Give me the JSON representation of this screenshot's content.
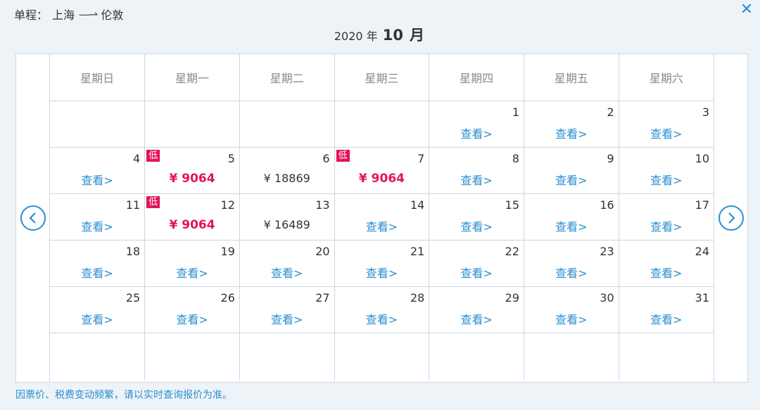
{
  "header": {
    "trip_type": "单程：",
    "origin": "上海",
    "arrow": "—⇀",
    "destination": "伦敦",
    "close_glyph": "✕"
  },
  "month": {
    "year": "2020",
    "year_unit": "年",
    "month": "10",
    "month_unit": "月"
  },
  "weekdays": [
    "星期日",
    "星期一",
    "星期二",
    "星期三",
    "星期四",
    "星期五",
    "星期六"
  ],
  "weeks": [
    [
      null,
      null,
      null,
      null,
      {
        "day": "1",
        "view": "查看>"
      },
      {
        "day": "2",
        "view": "查看>"
      },
      {
        "day": "3",
        "view": "查看>"
      }
    ],
    [
      {
        "day": "4",
        "view": "查看>"
      },
      {
        "day": "5",
        "badge": "低",
        "price": "¥ 9064",
        "low": true
      },
      {
        "day": "6",
        "price": "¥ 18869"
      },
      {
        "day": "7",
        "badge": "低",
        "price": "¥ 9064",
        "low": true
      },
      {
        "day": "8",
        "view": "查看>"
      },
      {
        "day": "9",
        "view": "查看>"
      },
      {
        "day": "10",
        "view": "查看>"
      }
    ],
    [
      {
        "day": "11",
        "view": "查看>"
      },
      {
        "day": "12",
        "badge": "低",
        "price": "¥ 9064",
        "low": true
      },
      {
        "day": "13",
        "price": "¥ 16489"
      },
      {
        "day": "14",
        "view": "查看>"
      },
      {
        "day": "15",
        "view": "查看>"
      },
      {
        "day": "16",
        "view": "查看>"
      },
      {
        "day": "17",
        "view": "查看>"
      }
    ],
    [
      {
        "day": "18",
        "view": "查看>"
      },
      {
        "day": "19",
        "view": "查看>"
      },
      {
        "day": "20",
        "view": "查看>"
      },
      {
        "day": "21",
        "view": "查看>"
      },
      {
        "day": "22",
        "view": "查看>"
      },
      {
        "day": "23",
        "view": "查看>"
      },
      {
        "day": "24",
        "view": "查看>"
      }
    ],
    [
      {
        "day": "25",
        "view": "查看>"
      },
      {
        "day": "26",
        "view": "查看>"
      },
      {
        "day": "27",
        "view": "查看>"
      },
      {
        "day": "28",
        "view": "查看>"
      },
      {
        "day": "29",
        "view": "查看>"
      },
      {
        "day": "30",
        "view": "查看>"
      },
      {
        "day": "31",
        "view": "查看>"
      }
    ],
    [
      null,
      null,
      null,
      null,
      null,
      null,
      null
    ]
  ],
  "footnote": "因票价、税费变动频繁，请以实时查询报价为准。",
  "colors": {
    "accent": "#2a8fd0",
    "low_price": "#e3135a",
    "border": "#c9d8e6"
  }
}
